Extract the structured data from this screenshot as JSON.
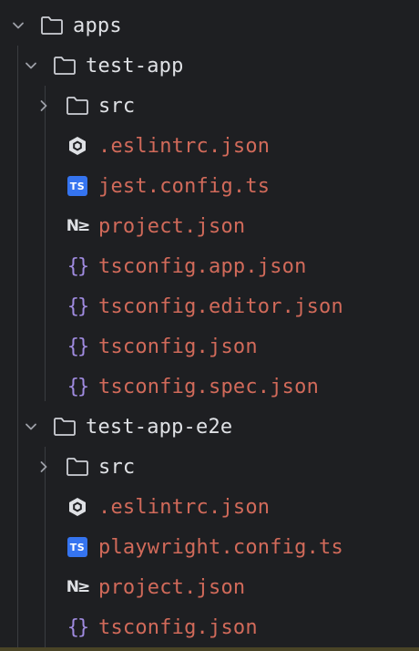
{
  "tree": {
    "apps": {
      "label": "apps",
      "expanded": true
    },
    "test_app": {
      "label": "test-app",
      "expanded": true,
      "children": {
        "src": {
          "label": "src",
          "expanded": false
        },
        "eslintrc": {
          "label": ".eslintrc.json",
          "icon": "eslint-icon"
        },
        "jest_config": {
          "label": "jest.config.ts",
          "icon": "typescript-icon",
          "badge": "TS"
        },
        "project": {
          "label": "project.json",
          "icon": "nx-icon",
          "badge": "N≥"
        },
        "tsconfig_app": {
          "label": "tsconfig.app.json",
          "icon": "json-icon",
          "badge": "{}"
        },
        "tsconfig_editor": {
          "label": "tsconfig.editor.json",
          "icon": "json-icon",
          "badge": "{}"
        },
        "tsconfig": {
          "label": "tsconfig.json",
          "icon": "json-icon",
          "badge": "{}"
        },
        "tsconfig_spec": {
          "label": "tsconfig.spec.json",
          "icon": "json-icon",
          "badge": "{}"
        }
      }
    },
    "test_app_e2e": {
      "label": "test-app-e2e",
      "expanded": true,
      "children": {
        "src": {
          "label": "src",
          "expanded": false
        },
        "eslintrc": {
          "label": ".eslintrc.json",
          "icon": "eslint-icon"
        },
        "playwright_config": {
          "label": "playwright.config.ts",
          "icon": "typescript-icon",
          "badge": "TS"
        },
        "project": {
          "label": "project.json",
          "icon": "nx-icon",
          "badge": "N≥"
        },
        "tsconfig": {
          "label": "tsconfig.json",
          "icon": "json-icon",
          "badge": "{}"
        }
      }
    }
  },
  "colors": {
    "background": "#1e1f22",
    "folder_text": "#dfe1e5",
    "file_text_error": "#d16a5a",
    "json_icon": "#a08be0",
    "ts_badge": "#3574f0"
  }
}
